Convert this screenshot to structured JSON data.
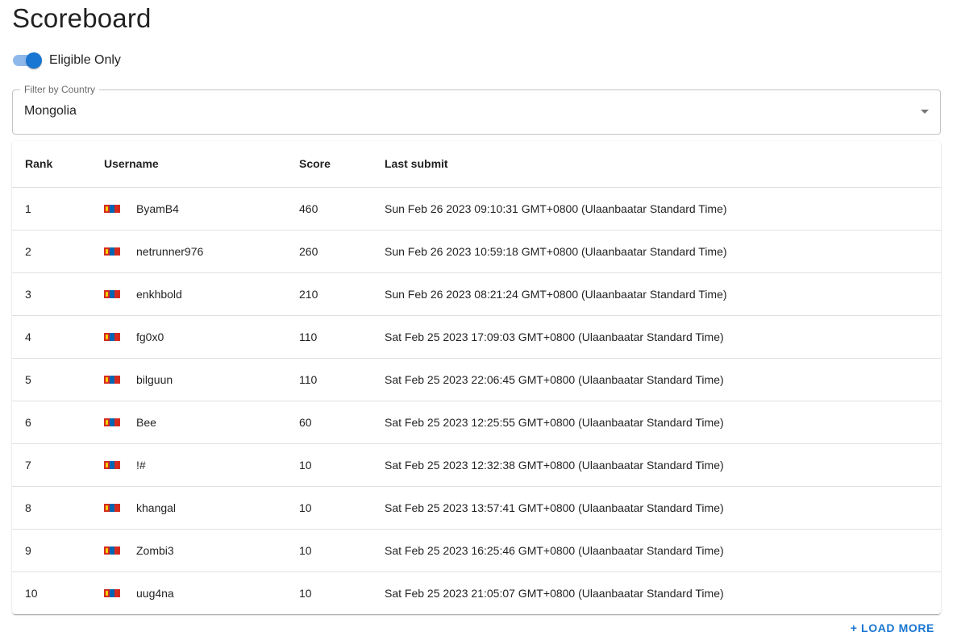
{
  "page": {
    "title": "Scoreboard"
  },
  "filters": {
    "eligible_label": "Eligible Only",
    "eligible_on": true,
    "country_label": "Filter by Country",
    "country_value": "Mongolia"
  },
  "table": {
    "headers": {
      "rank": "Rank",
      "username": "Username",
      "score": "Score",
      "last_submit": "Last submit"
    },
    "rows": [
      {
        "rank": "1",
        "country_flag": "mongolia-flag-icon",
        "username": "ByamB4",
        "score": "460",
        "last_submit": "Sun Feb 26 2023 09:10:31 GMT+0800 (Ulaanbaatar Standard Time)"
      },
      {
        "rank": "2",
        "country_flag": "mongolia-flag-icon",
        "username": "netrunner976",
        "score": "260",
        "last_submit": "Sun Feb 26 2023 10:59:18 GMT+0800 (Ulaanbaatar Standard Time)"
      },
      {
        "rank": "3",
        "country_flag": "mongolia-flag-icon",
        "username": "enkhbold",
        "score": "210",
        "last_submit": "Sun Feb 26 2023 08:21:24 GMT+0800 (Ulaanbaatar Standard Time)"
      },
      {
        "rank": "4",
        "country_flag": "mongolia-flag-icon",
        "username": "fg0x0",
        "score": "110",
        "last_submit": "Sat Feb 25 2023 17:09:03 GMT+0800 (Ulaanbaatar Standard Time)"
      },
      {
        "rank": "5",
        "country_flag": "mongolia-flag-icon",
        "username": "bilguun",
        "score": "110",
        "last_submit": "Sat Feb 25 2023 22:06:45 GMT+0800 (Ulaanbaatar Standard Time)"
      },
      {
        "rank": "6",
        "country_flag": "mongolia-flag-icon",
        "username": "Bee",
        "score": "60",
        "last_submit": "Sat Feb 25 2023 12:25:55 GMT+0800 (Ulaanbaatar Standard Time)"
      },
      {
        "rank": "7",
        "country_flag": "mongolia-flag-icon",
        "username": "!#",
        "score": "10",
        "last_submit": "Sat Feb 25 2023 12:32:38 GMT+0800 (Ulaanbaatar Standard Time)"
      },
      {
        "rank": "8",
        "country_flag": "mongolia-flag-icon",
        "username": "khangal",
        "score": "10",
        "last_submit": "Sat Feb 25 2023 13:57:41 GMT+0800 (Ulaanbaatar Standard Time)"
      },
      {
        "rank": "9",
        "country_flag": "mongolia-flag-icon",
        "username": "Zombi3",
        "score": "10",
        "last_submit": "Sat Feb 25 2023 16:25:46 GMT+0800 (Ulaanbaatar Standard Time)"
      },
      {
        "rank": "10",
        "country_flag": "mongolia-flag-icon",
        "username": "uug4na",
        "score": "10",
        "last_submit": "Sat Feb 25 2023 21:05:07 GMT+0800 (Ulaanbaatar Standard Time)"
      }
    ]
  },
  "actions": {
    "load_more": "+ LOAD MORE"
  },
  "colors": {
    "primary": "#1976d2",
    "primary_light": "#8fb8ea",
    "flag_red": "#d52b1e",
    "flag_blue": "#0066b3",
    "flag_gold": "#f9cf02"
  }
}
